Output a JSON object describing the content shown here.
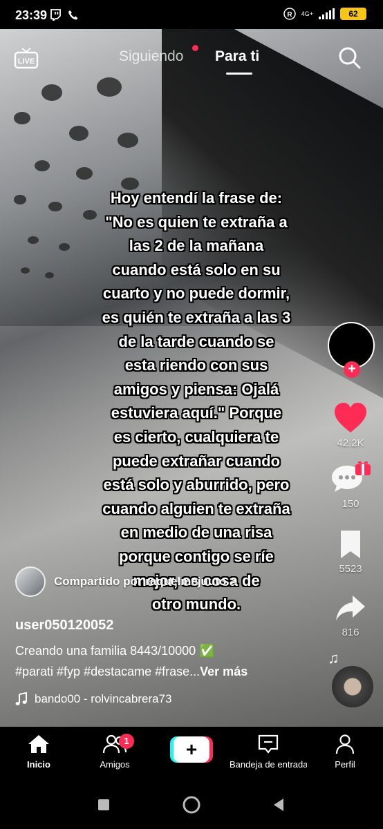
{
  "status_bar": {
    "time": "23:39",
    "network": "4G+",
    "battery": "62",
    "r_icon": "R"
  },
  "top_nav": {
    "live_label": "LIVE",
    "tab_following": "Siguiendo",
    "tab_for_you": "Para ti"
  },
  "overlay_text": "Hoy entendí la frase de:\n\"No es quien te extraña a\nlas 2 de la mañana\ncuando está solo en su\ncuarto y no puede dormir,\nes quién te extraña a las 3\nde la tarde cuando se\nesta riendo con sus\namigos y piensa: Ojalá\nestuviera aquí.\" Porque\nes cierto, cualquiera te\npuede extrañar cuando\nestá solo y aburrido, pero\ncuando alguien te extraña\nen medio de una risa\nporque contigo se ríe\nmejor, es cosa de\notro mundo.",
  "side_actions": {
    "likes": "42.2K",
    "comments": "150",
    "saves": "5523",
    "shares": "816"
  },
  "post": {
    "shared_by": "Compartido por raquelmejuuto",
    "shared_chevron": ">",
    "username": "user050120052",
    "caption": "Creando una familia 8443/10000 ✅",
    "hashtags": "#parati #fyp #destacame #frase...",
    "see_more": "Ver más",
    "music": "bando00 - rolvincabrera73"
  },
  "bottom_nav": {
    "home": "Inicio",
    "friends": "Amigos",
    "friends_badge": "1",
    "create": "+",
    "inbox": "Bandeja de entrada",
    "profile": "Perfil"
  },
  "colors": {
    "accent": "#fe2c55",
    "cyan": "#25f4ee",
    "battery": "#f5c518"
  }
}
